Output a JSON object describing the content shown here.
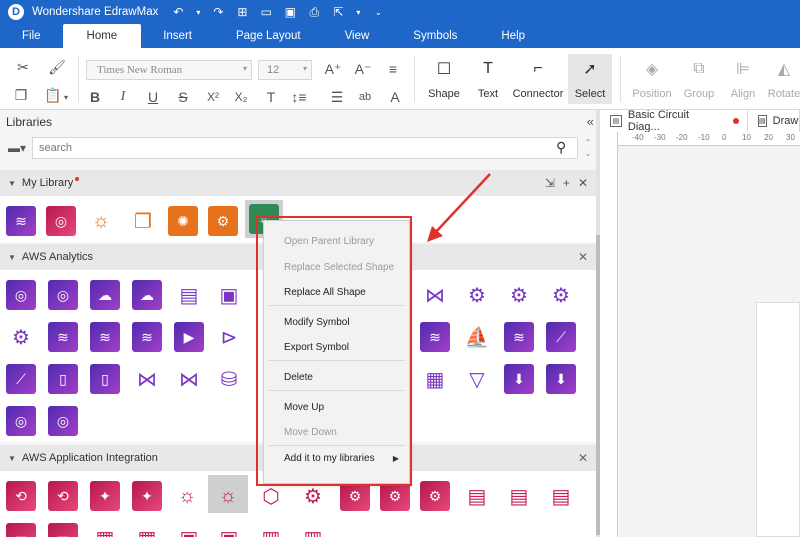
{
  "app": {
    "title": "Wondershare EdrawMax",
    "logo_glyph": "D"
  },
  "menubar": {
    "items": [
      "File",
      "Home",
      "Insert",
      "Page Layout",
      "View",
      "Symbols",
      "Help"
    ],
    "active": "Home"
  },
  "ribbon": {
    "font_family": "Times New Roman",
    "font_size": "12",
    "buttons": [
      {
        "label": "Shape",
        "icon": "square-icon"
      },
      {
        "label": "Text",
        "icon": "text-icon"
      },
      {
        "label": "Connector",
        "icon": "connector-icon"
      },
      {
        "label": "Select",
        "icon": "cursor-icon"
      },
      {
        "label": "Position",
        "icon": "layers-icon"
      },
      {
        "label": "Group",
        "icon": "group-icon"
      },
      {
        "label": "Align",
        "icon": "align-icon"
      },
      {
        "label": "Rotate",
        "icon": "rotate-icon"
      }
    ]
  },
  "libraries": {
    "title": "Libraries",
    "search_placeholder": "search",
    "sections": [
      {
        "name": "My Library",
        "modified": true
      },
      {
        "name": "AWS Analytics"
      },
      {
        "name": "AWS Application Integration"
      }
    ]
  },
  "document_tabs": [
    {
      "label": "Basic Circuit Diag...",
      "unsaved": true
    },
    {
      "label": "Drawin"
    }
  ],
  "ruler_ticks": [
    "-40",
    "-30",
    "-20",
    "-10",
    "0",
    "10",
    "20",
    "30"
  ],
  "context_menu": {
    "items": [
      {
        "label": "Open Parent Library",
        "enabled": false
      },
      {
        "label": "Replace Selected Shape",
        "enabled": false
      },
      {
        "label": "Replace All Shape",
        "enabled": true
      },
      {
        "label": "Modify Symbol",
        "enabled": true
      },
      {
        "label": "Export Symbol",
        "enabled": true
      },
      {
        "label": "Delete",
        "enabled": true
      },
      {
        "label": "Move Up",
        "enabled": true
      },
      {
        "label": "Move Down",
        "enabled": false
      },
      {
        "label": "Add it to my libraries",
        "enabled": true,
        "submenu": true
      }
    ]
  },
  "colors": {
    "brand_blue": "#1e66c8",
    "annotation_red": "#e0322a",
    "aws_purple": "#7a37c4",
    "aws_pink": "#c21d55"
  }
}
